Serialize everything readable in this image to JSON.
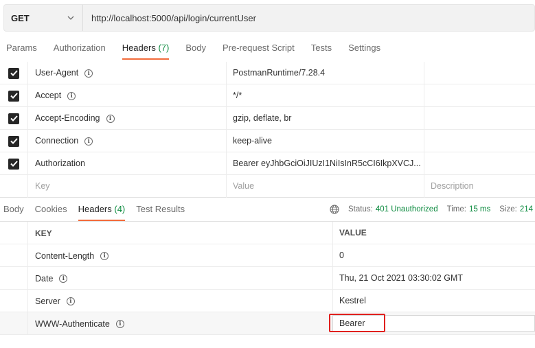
{
  "request": {
    "method": "GET",
    "url": "http://localhost:5000/api/login/currentUser"
  },
  "request_tabs": [
    {
      "label": "Params"
    },
    {
      "label": "Authorization"
    },
    {
      "label": "Headers",
      "count": "(7)"
    },
    {
      "label": "Body"
    },
    {
      "label": "Pre-request Script"
    },
    {
      "label": "Tests"
    },
    {
      "label": "Settings"
    }
  ],
  "request_headers": [
    {
      "key": "User-Agent",
      "value": "PostmanRuntime/7.28.4"
    },
    {
      "key": "Accept",
      "value": "*/*"
    },
    {
      "key": "Accept-Encoding",
      "value": "gzip, deflate, br"
    },
    {
      "key": "Connection",
      "value": "keep-alive"
    },
    {
      "key": "Authorization",
      "value": "Bearer eyJhbGciOiJIUzI1NiIsInR5cCI6IkpXVCJ..."
    }
  ],
  "request_placeholder": {
    "key": "Key",
    "value": "Value",
    "description": "Description"
  },
  "response_tabs": [
    {
      "label": "Body"
    },
    {
      "label": "Cookies"
    },
    {
      "label": "Headers",
      "count": "(4)"
    },
    {
      "label": "Test Results"
    }
  ],
  "response_status": {
    "status_label": "Status:",
    "status_value": "401 Unauthorized",
    "time_label": "Time:",
    "time_value": "15 ms",
    "size_label": "Size:",
    "size_value": "214"
  },
  "response_columns": {
    "key": "KEY",
    "value": "VALUE"
  },
  "response_headers": [
    {
      "key": "Content-Length",
      "value": "0"
    },
    {
      "key": "Date",
      "value": "Thu, 21 Oct 2021 03:30:02 GMT"
    },
    {
      "key": "Server",
      "value": "Kestrel"
    },
    {
      "key": "WWW-Authenticate",
      "value": "Bearer"
    }
  ],
  "colors": {
    "accent": "#f26b3a",
    "status_green": "#0b8a3e",
    "highlight_red": "#e0201e"
  }
}
